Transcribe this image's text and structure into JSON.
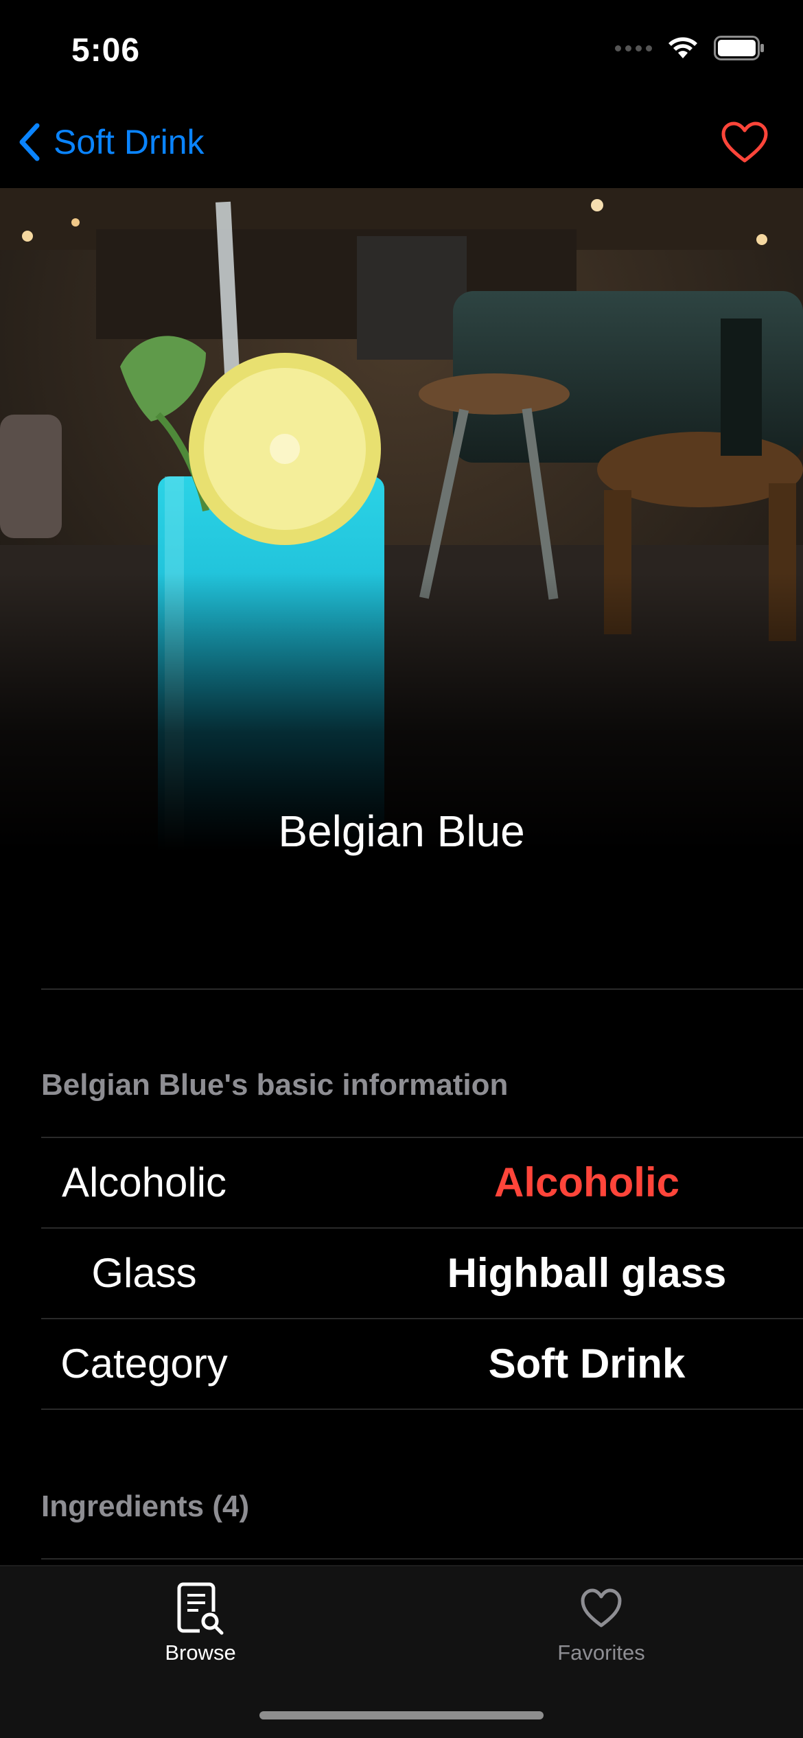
{
  "status_bar": {
    "time": "5:06"
  },
  "nav": {
    "back_label": "Soft Drink",
    "favorite_icon": "heart-outline-icon"
  },
  "drink": {
    "name": "Belgian Blue"
  },
  "basic_info": {
    "header": "Belgian Blue's basic information",
    "rows": [
      {
        "label": "Alcoholic",
        "value": "Alcoholic",
        "value_color": "#ff453a"
      },
      {
        "label": "Glass",
        "value": "Highball glass",
        "value_color": "#ffffff"
      },
      {
        "label": "Category",
        "value": "Soft Drink",
        "value_color": "#ffffff"
      }
    ]
  },
  "ingredients": {
    "header": "Ingredients (4)"
  },
  "tabs": [
    {
      "label": "Browse",
      "icon": "browse-document-search-icon",
      "selected": true
    },
    {
      "label": "Favorites",
      "icon": "heart-icon",
      "selected": false
    }
  ],
  "colors": {
    "accent": "#0a84ff",
    "favorite": "#ff453a",
    "inactive": "#8e8e93"
  }
}
